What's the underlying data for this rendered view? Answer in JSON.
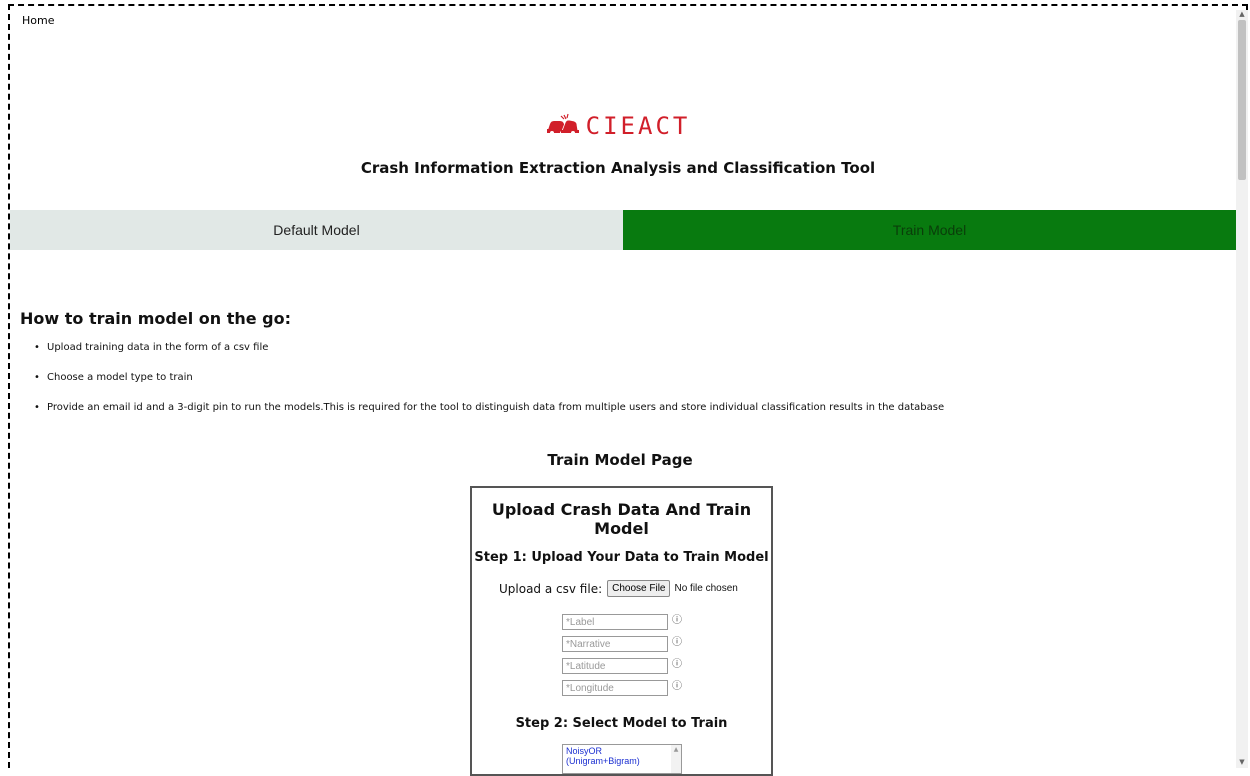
{
  "nav": {
    "home_label": "Home"
  },
  "brand": {
    "logo_text": "CIEACT",
    "subtitle": "Crash Information Extraction Analysis and Classification Tool",
    "accent_color": "#d11f2a"
  },
  "tabs": [
    {
      "label": "Default Model",
      "active": false
    },
    {
      "label": "Train Model",
      "active": true,
      "color": "#087a0f"
    }
  ],
  "instructions": {
    "heading": "How to train model on the go:",
    "items": [
      "Upload training data in the form of a csv file",
      "Choose a model type to train",
      "Provide an email id and a 3-digit pin to run the models.This is required for the tool to distinguish data from multiple users and store individual classification results in the database"
    ]
  },
  "train_page": {
    "title": "Train Model Page",
    "panel_title": "Upload Crash Data And Train Model",
    "step1_title": "Step 1: Upload Your Data to Train Model",
    "upload_label": "Upload a csv file:",
    "choose_file_label": "Choose File",
    "no_file_text": "No file chosen",
    "fields": [
      {
        "placeholder": "*Label",
        "icon": "info-icon"
      },
      {
        "placeholder": "*Narrative",
        "icon": "info-icon"
      },
      {
        "placeholder": "*Latitude",
        "icon": "info-icon"
      },
      {
        "placeholder": "*Longitude",
        "icon": "info-icon"
      }
    ],
    "step2_title": "Step 2: Select Model to Train",
    "model_options": [
      "NoisyOR (Unigram+Bigram)"
    ]
  }
}
